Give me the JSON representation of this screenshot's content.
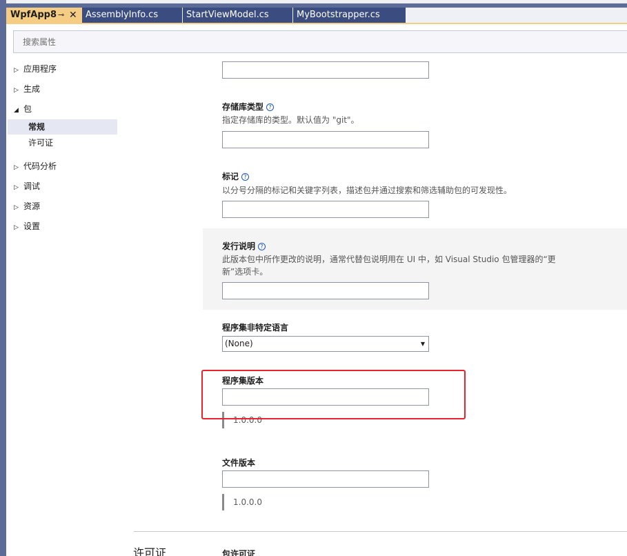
{
  "tabs": [
    {
      "label": "WpfApp8",
      "active": true,
      "pin": "⊸",
      "close": "✕"
    },
    {
      "label": "AssemblyInfo.cs",
      "active": false
    },
    {
      "label": "StartViewModel.cs",
      "active": false
    },
    {
      "label": "MyBootstrapper.cs",
      "active": false
    }
  ],
  "search": {
    "placeholder": "搜索属性"
  },
  "sidebar": {
    "items": [
      {
        "label": "应用程序",
        "expanded": false
      },
      {
        "label": "生成",
        "expanded": false
      },
      {
        "label": "包",
        "expanded": true
      },
      {
        "label": "代码分析",
        "expanded": false
      },
      {
        "label": "调试",
        "expanded": false
      },
      {
        "label": "资源",
        "expanded": false
      },
      {
        "label": "设置",
        "expanded": false
      }
    ],
    "package_children": [
      {
        "label": "常规",
        "selected": true
      },
      {
        "label": "许可证",
        "selected": false
      }
    ]
  },
  "form": {
    "repo_type": {
      "title": "存储库类型",
      "desc": "指定存储库的类型。默认值为 \"git\"。",
      "value": ""
    },
    "tags": {
      "title": "标记",
      "desc": "以分号分隔的标记和关键字列表，描述包并通过搜索和筛选辅助包的可发现性。",
      "value": ""
    },
    "release_notes": {
      "title": "发行说明",
      "desc_line1": "此版本包中所作更改的说明，通常代替包说明用在 UI 中，如 Visual Studio 包管理器的“更",
      "desc_line2": "新”选项卡。",
      "value": ""
    },
    "neutral_language": {
      "title": "程序集非特定语言",
      "value": "(None)"
    },
    "assembly_version": {
      "title": "程序集版本",
      "value": "",
      "default": "1.0.0.0"
    },
    "file_version": {
      "title": "文件版本",
      "value": "",
      "default": "1.0.0.0"
    }
  },
  "license_section": {
    "title": "许可证",
    "field_title": "包许可证"
  },
  "colors": {
    "frame": "#5d6b99",
    "active_tab": "#f5cc84",
    "inactive_tab": "#3b4c80",
    "highlight": "#e8222a"
  }
}
